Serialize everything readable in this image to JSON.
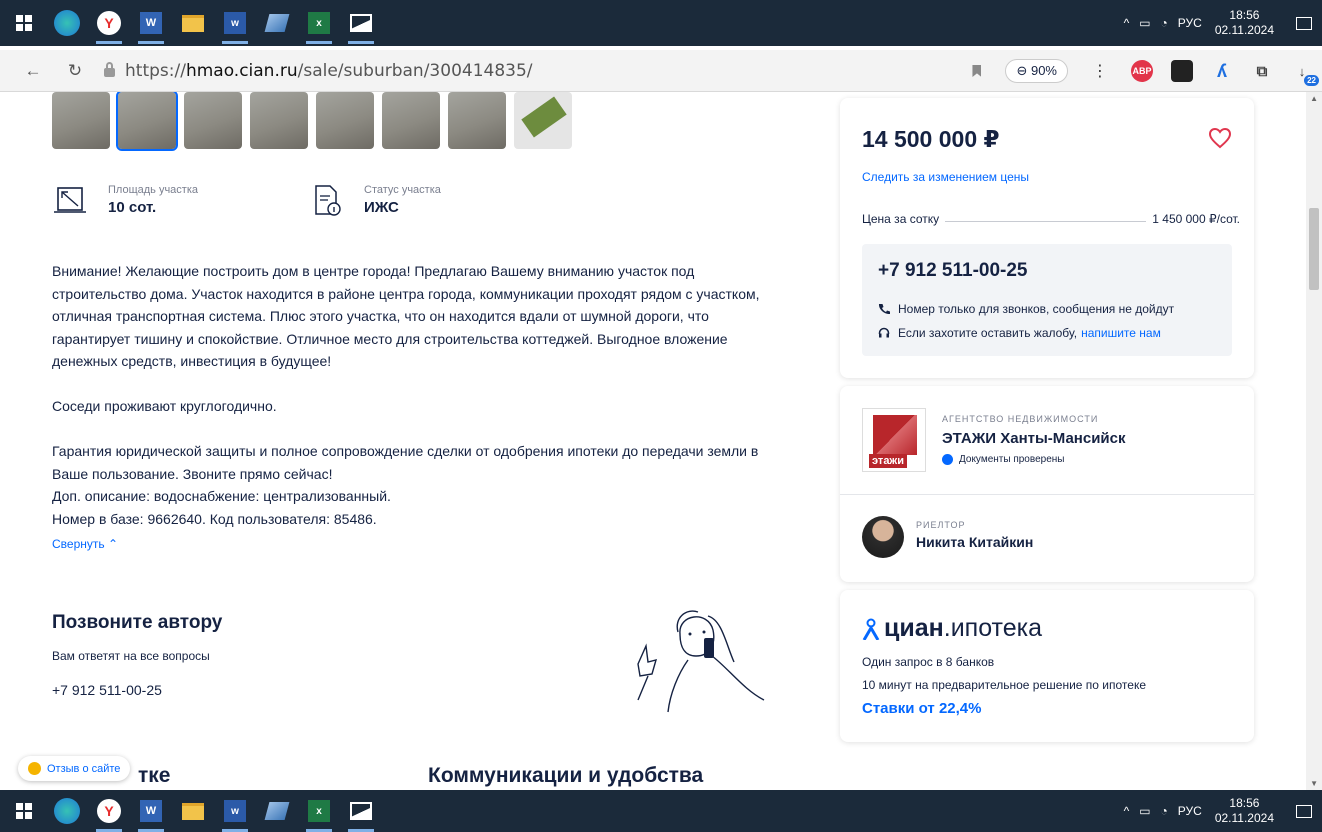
{
  "taskbar": {
    "apps": [
      "edge-icon",
      "yandex-browser-icon",
      "publisher-icon",
      "file-explorer-icon",
      "word-icon",
      "app-icon",
      "excel-icon",
      "photos-icon"
    ],
    "lang": "РУС",
    "time": "18:56",
    "date": "02.11.2024"
  },
  "browser": {
    "url_prefix": "https://",
    "url_host": "hmao.cian.ru",
    "url_path": "/sale/suburban/300414835/",
    "zoom": "90%",
    "abp_label": "ABP",
    "downloads_badge": "22"
  },
  "listing": {
    "facts": [
      {
        "label": "Площадь участка",
        "value": "10 сот."
      },
      {
        "label": "Статус участка",
        "value": "ИЖС"
      }
    ],
    "description": [
      "Внимание! Желающие построить дом в центре города! Предлагаю Вашему вниманию участок под строительство дома. Участок находится в районе центра города, коммуникации проходят рядом с участком, отличная транспортная система. Плюс этого участка, что он находится вдали от шумной дороги, что гарантирует тишину и спокойствие. Отличное место для строительства коттеджей. Выгодное вложение денежных средств, инвестиция в будущее!",
      "Соседи проживают круглогодично.",
      "Гарантия юридической защиты и полное сопровождение сделки от одобрения ипотеки до передачи земли в Ваше пользование. Звоните прямо сейчас!\n Доп. описание: водоснабжение: централизованный.\nНомер в базе: 9662640. Код пользователя: 85486."
    ],
    "collapse_label": "Свернуть",
    "call_title": "Позвоните автору",
    "call_sub": "Вам ответят на все вопросы",
    "call_phone": "+7 912 511-00-25",
    "section_left": "тке",
    "section_right": "Коммуникации и удобства",
    "feedback": "Отзыв о сайте"
  },
  "price_card": {
    "price": "14 500 000 ₽",
    "follow": "Следить за изменением цены",
    "per_sotka_label": "Цена за сотку",
    "per_sotka_value": "1 450 000 ₽/сот.",
    "phone": "+7 912 511-00-25",
    "calls_only": "Номер только для звонков, сообщения не дойдут",
    "complaint": "Если захотите оставить жалобу,",
    "complaint_link": "напишите нам"
  },
  "agency_card": {
    "kind": "АГЕНТСТВО НЕДВИЖИМОСТИ",
    "name": "ЭТАЖИ Ханты-Мансийск",
    "logo_text": "этажи",
    "verified": "Документы проверены",
    "realtor_kind": "РИЕЛТОР",
    "realtor_name": "Никита Китайкин"
  },
  "mortgage_card": {
    "brand": "циан",
    "brand_suffix": ".ипотека",
    "line1": "Один запрос в 8 банков",
    "line2": "10 минут на предварительное решение по ипотеке",
    "rates": "Ставки от 22,4%"
  },
  "colors": {
    "accent": "#0468ff",
    "text": "#152242",
    "taskbar": "#1b2a3a",
    "heart": "#e0364e"
  }
}
